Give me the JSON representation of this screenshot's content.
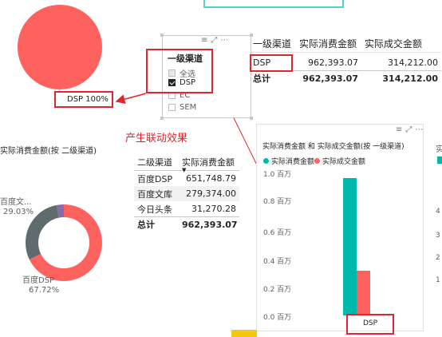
{
  "colors": {
    "coral": "#fd625e",
    "teal": "#01b8aa",
    "dark_gray": "#5f6b6d",
    "purple": "#8a6ba8",
    "annotation_red": "#e0262d"
  },
  "pie_chart": {
    "label": "DSP 100%"
  },
  "slicer": {
    "title": "一级渠道",
    "items": [
      {
        "label": "全选",
        "state": "partial"
      },
      {
        "label": "DSP",
        "state": "checked"
      },
      {
        "label": "EC",
        "state": "unchecked"
      },
      {
        "label": "SEM",
        "state": "unchecked"
      }
    ],
    "icons": [
      "drag-handle-icon",
      "focus-mode-icon",
      "more-options-icon"
    ]
  },
  "channel_table": {
    "headers": [
      "一级渠道",
      "实际消费金额",
      "实际成交金额"
    ],
    "rows": [
      {
        "channel": "DSP",
        "spend": "962,393.07",
        "deal": "314,212.00"
      }
    ],
    "total": {
      "label": "总计",
      "spend": "962,393.07",
      "deal": "314,212.00"
    }
  },
  "annotation": {
    "text": "产生联动效果"
  },
  "subchannel_table": {
    "headers": [
      "二级渠道",
      "实际消费金额"
    ],
    "rows": [
      {
        "channel": "百度DSP",
        "spend": "651,748.79"
      },
      {
        "channel": "百度文库",
        "spend": "279,374.00"
      },
      {
        "channel": "今日头条",
        "spend": "31,270.28"
      }
    ],
    "total": {
      "label": "总计",
      "spend": "962,393.07"
    }
  },
  "donut_chart": {
    "title": "实际消费金额(按 二级渠道)",
    "labels": [
      {
        "name": "百度文...",
        "pct": "29.03%"
      },
      {
        "name": "百度DSP",
        "pct": "67.72%"
      }
    ]
  },
  "bar_chart": {
    "title": "实际消费金额 和 实际成交金额(按 一级渠道)",
    "icons": [
      "drag-handle-icon",
      "focus-mode-icon",
      "more-options-icon"
    ]
  },
  "chart_data": [
    {
      "type": "pie",
      "categories": [
        "DSP"
      ],
      "values": [
        100
      ],
      "labels": [
        "DSP 100%"
      ]
    },
    {
      "type": "pie",
      "title": "实际消费金额(按 二级渠道)",
      "categories": [
        "百度DSP",
        "百度文库",
        "今日头条"
      ],
      "values": [
        651748.79,
        279374.0,
        31270.28
      ],
      "labels": [
        "百度DSP 67.72%",
        "百度文... 29.03%"
      ]
    },
    {
      "type": "bar",
      "title": "实际消费金额 和 实际成交金额(按 一级渠道)",
      "categories": [
        "DSP"
      ],
      "series": [
        {
          "name": "实际消费金额",
          "values": [
            962393.07
          ],
          "color": "#01b8aa"
        },
        {
          "name": "实际成交金额",
          "values": [
            314212.0
          ],
          "color": "#fd625e"
        }
      ],
      "yticks": [
        "1.0 百万",
        "0.8 百万",
        "0.6 百万",
        "0.4 百万",
        "0.2 百万",
        "0.0 百万"
      ],
      "ylim": [
        0,
        1000000
      ],
      "legend": "top-left"
    }
  ],
  "right_partial": {
    "title_char": "实",
    "ticks": [
      "4",
      "3",
      "2",
      "1"
    ]
  }
}
